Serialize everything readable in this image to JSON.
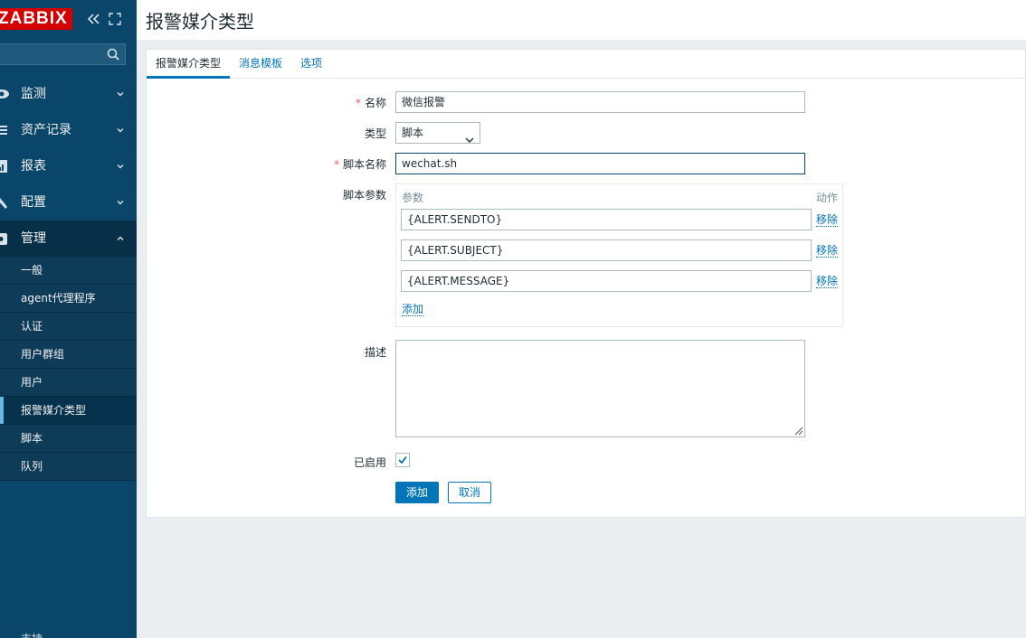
{
  "app": {
    "logo_text": "ZABBIX",
    "colors": {
      "sidebar": "#0a466a",
      "accent": "#0275b8",
      "logo_red": "#d40000"
    }
  },
  "sidebar": {
    "menu": [
      {
        "label": "监测",
        "icon": "eye-icon"
      },
      {
        "label": "资产记录",
        "icon": "list-icon"
      },
      {
        "label": "报表",
        "icon": "report-icon"
      },
      {
        "label": "配置",
        "icon": "wrench-icon"
      },
      {
        "label": "管理",
        "icon": "gear-icon"
      }
    ],
    "admin_items": [
      "一般",
      "agent代理程序",
      "认证",
      "用户群组",
      "用户",
      "报警媒介类型",
      "脚本",
      "队列"
    ],
    "support_label": "支持"
  },
  "page": {
    "title": "报警媒介类型"
  },
  "tabs": [
    "报警媒介类型",
    "消息模板",
    "选项"
  ],
  "form": {
    "name_label": "名称",
    "name_value": "微信报警",
    "type_label": "类型",
    "type_value": "脚本",
    "script_name_label": "脚本名称",
    "script_name_value": "wechat.sh",
    "script_params_label": "脚本参数",
    "params_header": "参数",
    "actions_header": "动作",
    "params": [
      "{ALERT.SENDTO}",
      "{ALERT.SUBJECT}",
      "{ALERT.MESSAGE}"
    ],
    "remove_label": "移除",
    "add_param_label": "添加",
    "description_label": "描述",
    "description_value": "",
    "enabled_label": "已启用",
    "enabled": true,
    "add_button": "添加",
    "cancel_button": "取消"
  }
}
